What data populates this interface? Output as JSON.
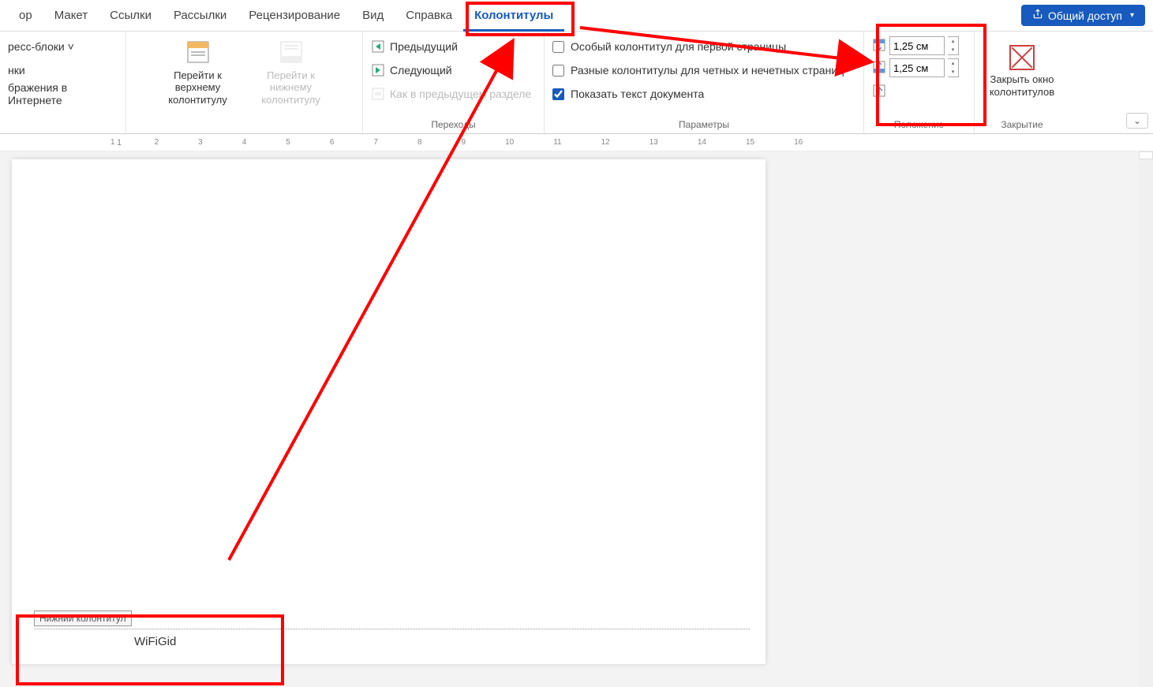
{
  "tabs": {
    "items": [
      "ор",
      "Макет",
      "Ссылки",
      "Рассылки",
      "Рецензирование",
      "Вид",
      "Справка",
      "Колонтитулы"
    ],
    "active_index": 7
  },
  "share": {
    "label": "Общий доступ"
  },
  "ribbon": {
    "left_items": [
      "ресс-блоки ˅",
      "нки",
      "бражения в Интернете"
    ],
    "nav": {
      "to_top": "Перейти к верхнему колонтитулу",
      "to_bottom": "Перейти к нижнему колонтитулу"
    },
    "transitions": {
      "prev": "Предыдущий",
      "next": "Следующий",
      "same_as_prev": "Как в предыдущем разделе",
      "group_label": "Переходы"
    },
    "params": {
      "first_page": "Особый колонтитул для первой страницы",
      "odd_even": "Разные колонтитулы для четных и нечетных страниц",
      "show_text": "Показать текст документа",
      "show_text_checked": true,
      "group_label": "Параметры"
    },
    "position": {
      "header_val": "1,25 см",
      "footer_val": "1,25 см",
      "group_label": "Положение"
    },
    "close": {
      "label": "Закрыть окно колонтитулов",
      "group_label": "Закрытие"
    }
  },
  "ruler": {
    "nums": [
      "1",
      "2",
      "3",
      "4",
      "5",
      "6",
      "7",
      "8",
      "9",
      "10",
      "11",
      "12",
      "13",
      "14",
      "15",
      "16"
    ]
  },
  "page_marker": "1",
  "footer": {
    "tab_label": "Нижний колонтитул",
    "text": "WiFiGid"
  }
}
